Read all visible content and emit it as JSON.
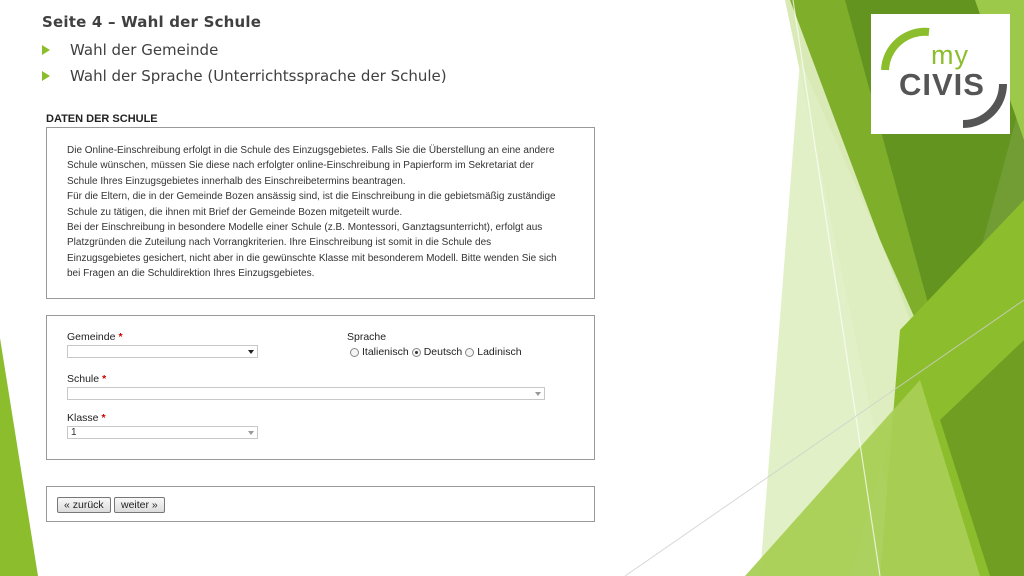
{
  "slide": {
    "title": "Seite 4 – Wahl der Schule",
    "bullets": [
      "Wahl der Gemeinde",
      "Wahl der Sprache (Unterrichtssprache der Schule)"
    ]
  },
  "logo": {
    "my": "my",
    "civis": "CIVIS",
    "colors": {
      "green": "#8cbd2c",
      "grey": "#555555"
    }
  },
  "section": {
    "heading": "DATEN DER SCHULE"
  },
  "info": {
    "lines": [
      "Die Online-Einschreibung erfolgt in die Schule des Einzugsgebietes. Falls Sie die Überstellung an eine andere",
      "Schule wünschen, müssen Sie diese nach erfolgter online-Einschreibung in Papierform im Sekretariat der",
      "Schule Ihres Einzugsgebietes innerhalb des Einschreibetermins beantragen.",
      "Für die Eltern, die in der Gemeinde Bozen ansässig sind, ist die Einschreibung in die gebietsmäßig zuständige",
      "Schule zu tätigen, die ihnen mit Brief der Gemeinde Bozen mitgeteilt wurde.",
      "Bei der Einschreibung in besondere Modelle einer Schule (z.B. Montessori, Ganztagsunterricht), erfolgt aus",
      "Platzgründen die Zuteilung nach Vorrangkriterien. Ihre Einschreibung ist somit in die Schule des",
      "Einzugsgebietes gesichert, nicht aber in die gewünschte Klasse mit besonderem Modell. Bitte wenden Sie sich",
      "bei Fragen an die Schuldirektion Ihres Einzugsgebietes."
    ]
  },
  "form": {
    "gemeinde": {
      "label": "Gemeinde",
      "required": "*",
      "value": ""
    },
    "sprache": {
      "label": "Sprache",
      "options": [
        "Italienisch",
        "Deutsch",
        "Ladinisch"
      ],
      "selected": "Deutsch"
    },
    "schule": {
      "label": "Schule",
      "required": "*",
      "value": ""
    },
    "klasse": {
      "label": "Klasse",
      "required": "*",
      "value": "1"
    }
  },
  "nav": {
    "back_label": "« zurück",
    "next_label": "weiter »"
  },
  "theme": {
    "accent": "#8cbd2c",
    "accent_dark": "#5f8f1f",
    "accent_light": "#d3e6a6"
  }
}
